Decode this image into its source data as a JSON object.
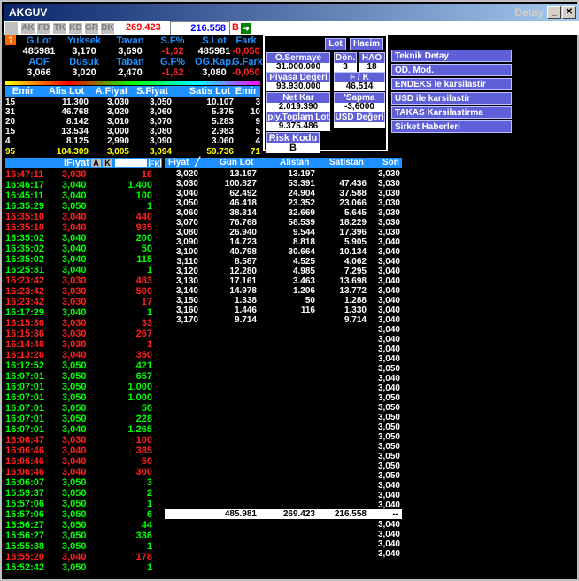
{
  "window": {
    "title": "AKGUV",
    "detail_label": "Detay"
  },
  "toolbar": {
    "buttons": [
      "AK",
      "FD",
      "TK",
      "KD",
      "GR",
      "DK"
    ],
    "price": "269.423",
    "value": "216.558",
    "b_label": "B",
    "flag": "?"
  },
  "summary": {
    "row1_headers": [
      "G.Lot",
      "Yuksek",
      "Tavan",
      "S.F%",
      "S.Lot",
      "Fark"
    ],
    "row1_values": [
      "485981",
      "3,170",
      "3,690",
      "-1,62",
      "485981",
      "-0,050"
    ],
    "row2_headers": [
      "AOF",
      "Dusuk",
      "Taban",
      "G.F%",
      "OG.Kap.",
      "G.Fark"
    ],
    "row2_values": [
      "3,066",
      "3,020",
      "2,470",
      "-1,62",
      "3,080",
      "-0,050"
    ]
  },
  "depth": {
    "headers": [
      "Emir",
      "Alis Lot",
      "A.Fiyat",
      "S.Fiyat",
      "Satis Lot",
      "Emir"
    ],
    "rows": [
      [
        "15",
        "11.300",
        "3,030",
        "3,050",
        "10.107",
        "3"
      ],
      [
        "31",
        "46.768",
        "3,020",
        "3,060",
        "5.375",
        "10"
      ],
      [
        "20",
        "8.142",
        "3,010",
        "3,070",
        "5.283",
        "9"
      ],
      [
        "15",
        "13.534",
        "3,000",
        "3,080",
        "2.983",
        "5"
      ],
      [
        "4",
        "8.125",
        "2,990",
        "3,090",
        "3.060",
        "4"
      ]
    ],
    "totals": [
      "95",
      "104.309",
      "3,005",
      "3,094",
      "59.736",
      "71"
    ]
  },
  "panel": {
    "lot_label": "Lot",
    "hacim_label": "Hacim",
    "osermaye_label": "Ö.Sermaye",
    "osermaye_value": "31.000.000",
    "don_label": "Dön.",
    "don_value": "3",
    "hao_label": "HAO",
    "hao_value": "18",
    "piyasa_label": "Piyasa Değeri",
    "piyasa_value": "93.930.000",
    "fk_label": "F / K",
    "fk_value": "46,514",
    "netkar_label": "Net Kar",
    "netkar_value": "2.019.390",
    "sapma_label": "'Sapma",
    "sapma_value": "-3,6000",
    "toplamlot_label": "piy.Toplam Lot",
    "toplamlot_value": "9.375.486",
    "usd_label": "USD Değeri",
    "risk_label": "Risk Kodu",
    "risk_value": "B"
  },
  "menu": [
    "Teknik Detay",
    "OD. Mod.",
    "ENDEKS le karsilastir",
    "USD ile karsilastir",
    "TAKAS Karsilastirma",
    "Sirket Haberleri"
  ],
  "trades_header": {
    "fiyat": "IFiyat",
    "a": "A",
    "k": "K",
    "fk": "FK"
  },
  "trades": [
    [
      "16:47:11",
      "3,030",
      "16",
      "r"
    ],
    [
      "16:46:17",
      "3,040",
      "1.400",
      "g"
    ],
    [
      "16:45:11",
      "3,040",
      "100",
      "g"
    ],
    [
      "16:35:29",
      "3,050",
      "1",
      "g"
    ],
    [
      "16:35:10",
      "3,040",
      "440",
      "r"
    ],
    [
      "16:35:10",
      "3,040",
      "935",
      "r"
    ],
    [
      "16:35:02",
      "3,040",
      "200",
      "g"
    ],
    [
      "16:35:02",
      "3,040",
      "50",
      "g"
    ],
    [
      "16:35:02",
      "3,040",
      "115",
      "g"
    ],
    [
      "16:25:31",
      "3,040",
      "1",
      "g"
    ],
    [
      "16:23:42",
      "3,030",
      "483",
      "r"
    ],
    [
      "16:23:42",
      "3,030",
      "500",
      "r"
    ],
    [
      "16:23:42",
      "3,030",
      "17",
      "r"
    ],
    [
      "16:17:29",
      "3,040",
      "1",
      "g"
    ],
    [
      "16:15:36",
      "3,030",
      "33",
      "r"
    ],
    [
      "16:15:36",
      "3,030",
      "267",
      "r"
    ],
    [
      "16:14:48",
      "3,030",
      "1",
      "r"
    ],
    [
      "16:13:26",
      "3,040",
      "350",
      "r"
    ],
    [
      "16:12:52",
      "3,050",
      "421",
      "g"
    ],
    [
      "16:07:01",
      "3,050",
      "657",
      "g"
    ],
    [
      "16:07:01",
      "3,050",
      "1.000",
      "g"
    ],
    [
      "16:07:01",
      "3,050",
      "1.000",
      "g"
    ],
    [
      "16:07:01",
      "3,050",
      "50",
      "g"
    ],
    [
      "16:07:01",
      "3,050",
      "228",
      "g"
    ],
    [
      "16:07:01",
      "3,040",
      "1.265",
      "g"
    ],
    [
      "16:06:47",
      "3,030",
      "100",
      "r"
    ],
    [
      "16:06:46",
      "3,040",
      "385",
      "r"
    ],
    [
      "16:06:46",
      "3,040",
      "50",
      "r"
    ],
    [
      "16:06:46",
      "3,040",
      "300",
      "r"
    ],
    [
      "16:06:07",
      "3,050",
      "3",
      "g"
    ],
    [
      "15:59:37",
      "3,050",
      "2",
      "g"
    ],
    [
      "15:57:06",
      "3,050",
      "1",
      "g"
    ],
    [
      "15:57:06",
      "3,050",
      "6",
      "g"
    ],
    [
      "15:56:27",
      "3,050",
      "44",
      "g"
    ],
    [
      "15:56:27",
      "3,050",
      "336",
      "g"
    ],
    [
      "15:55:38",
      "3,050",
      "1",
      "g"
    ],
    [
      "15:55:20",
      "3,040",
      "178",
      "r"
    ],
    [
      "15:52:42",
      "3,050",
      "1",
      "g"
    ]
  ],
  "dist_header": {
    "fiyat": "Fiyat",
    "gun_lot": "Gun Lot",
    "alistan": "Alistan",
    "satistan": "Satistan",
    "son": "Son"
  },
  "dist": [
    [
      "3,020",
      "13.197",
      "13.197",
      ""
    ],
    [
      "3,030",
      "100.827",
      "53.391",
      "47.436"
    ],
    [
      "3,040",
      "62.492",
      "24.904",
      "37.588"
    ],
    [
      "3,050",
      "46.418",
      "23.352",
      "23.066"
    ],
    [
      "3,060",
      "38.314",
      "32.669",
      "5.645"
    ],
    [
      "3,070",
      "76.768",
      "58.539",
      "18.229"
    ],
    [
      "3,080",
      "26.940",
      "9.544",
      "17.396"
    ],
    [
      "3,090",
      "14.723",
      "8.818",
      "5.905"
    ],
    [
      "3,100",
      "40.798",
      "30.664",
      "10.134"
    ],
    [
      "3,110",
      "8.587",
      "4.525",
      "4.062"
    ],
    [
      "3,120",
      "12.280",
      "4.985",
      "7.295"
    ],
    [
      "3,130",
      "17.161",
      "3.463",
      "13.698"
    ],
    [
      "3,140",
      "14.978",
      "1.206",
      "13.772"
    ],
    [
      "3,150",
      "1.338",
      "50",
      "1.288"
    ],
    [
      "3,160",
      "1.446",
      "116",
      "1.330"
    ],
    [
      "3,170",
      "9.714",
      "",
      "9.714"
    ]
  ],
  "son_values": [
    "3,030",
    "3,030",
    "3,030",
    "3,030",
    "3,030",
    "3,030",
    "3,030",
    "3,040",
    "3,040",
    "3,040",
    "3,040",
    "3,040",
    "3,040",
    "3,040",
    "3,040",
    "3,040",
    "3,040",
    "3,040",
    "3,040",
    "3,040",
    "3,050",
    "3,040",
    "3,040",
    "3,050",
    "3,050",
    "3,050",
    "3,050",
    "3,050",
    "3,050",
    "3,050",
    "3,050",
    "3,050",
    "3,040",
    "3,040",
    "3,040",
    "3,040",
    "3,040",
    "3,040",
    "3,040",
    "3,040"
  ],
  "totals_row": {
    "gun_lot": "485.981",
    "alistan": "269.423",
    "satistan": "216.558",
    "son": "--"
  },
  "colors": {
    "red": "#ff2020",
    "green": "#00ff00",
    "blue": "#1e90ff",
    "yellow": "#ffff00"
  }
}
